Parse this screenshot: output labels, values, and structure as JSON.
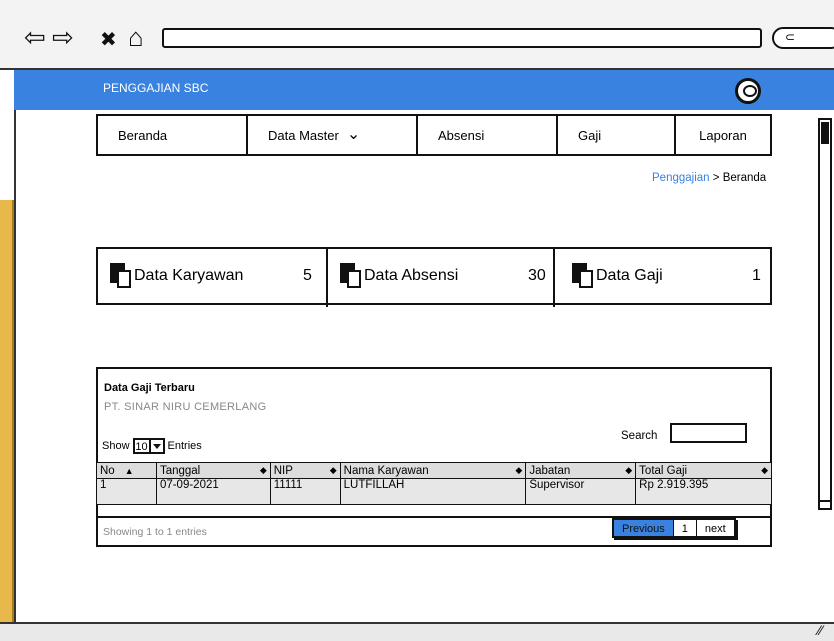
{
  "browser": {
    "back_icon": "⇦",
    "forward_icon": "⇨",
    "close_icon": "✖",
    "home_icon": "⌂",
    "search_pill_icon": "⊂"
  },
  "app": {
    "brand": "PENGGAJIAN SBC",
    "accent": "#3a82e0"
  },
  "menu": [
    {
      "label": "Beranda"
    },
    {
      "label": "Data Master",
      "chevron": "⌄"
    },
    {
      "label": "Absensi"
    },
    {
      "label": "Gaji"
    },
    {
      "label": "Laporan"
    }
  ],
  "breadcrumb": {
    "link": "Penggajian",
    "separator": ">",
    "current": "Beranda"
  },
  "cards": [
    {
      "label": "Data Karyawan",
      "count": "5"
    },
    {
      "label": "Data Absensi",
      "count": "30"
    },
    {
      "label": "Data Gaji",
      "count": "1"
    }
  ],
  "table": {
    "title": "Data Gaji Terbaru",
    "subtitle": "PT. SINAR NIRU CEMERLANG",
    "show_label": "Show",
    "show_value": "10",
    "entries_label": "Entries",
    "search_label": "Search",
    "columns": [
      "No",
      "Tanggal",
      "NIP",
      "Nama Karyawan",
      "Jabatan",
      "Total Gaji"
    ],
    "rows": [
      [
        "1",
        "07-09-2021",
        "11111",
        "LUTFILLAH",
        "Supervisor",
        "Rp 2.919.395"
      ]
    ],
    "showing_text": "Showing 1 to 1 entries",
    "pager": {
      "previous": "Previous",
      "page": "1",
      "next": "next"
    }
  }
}
